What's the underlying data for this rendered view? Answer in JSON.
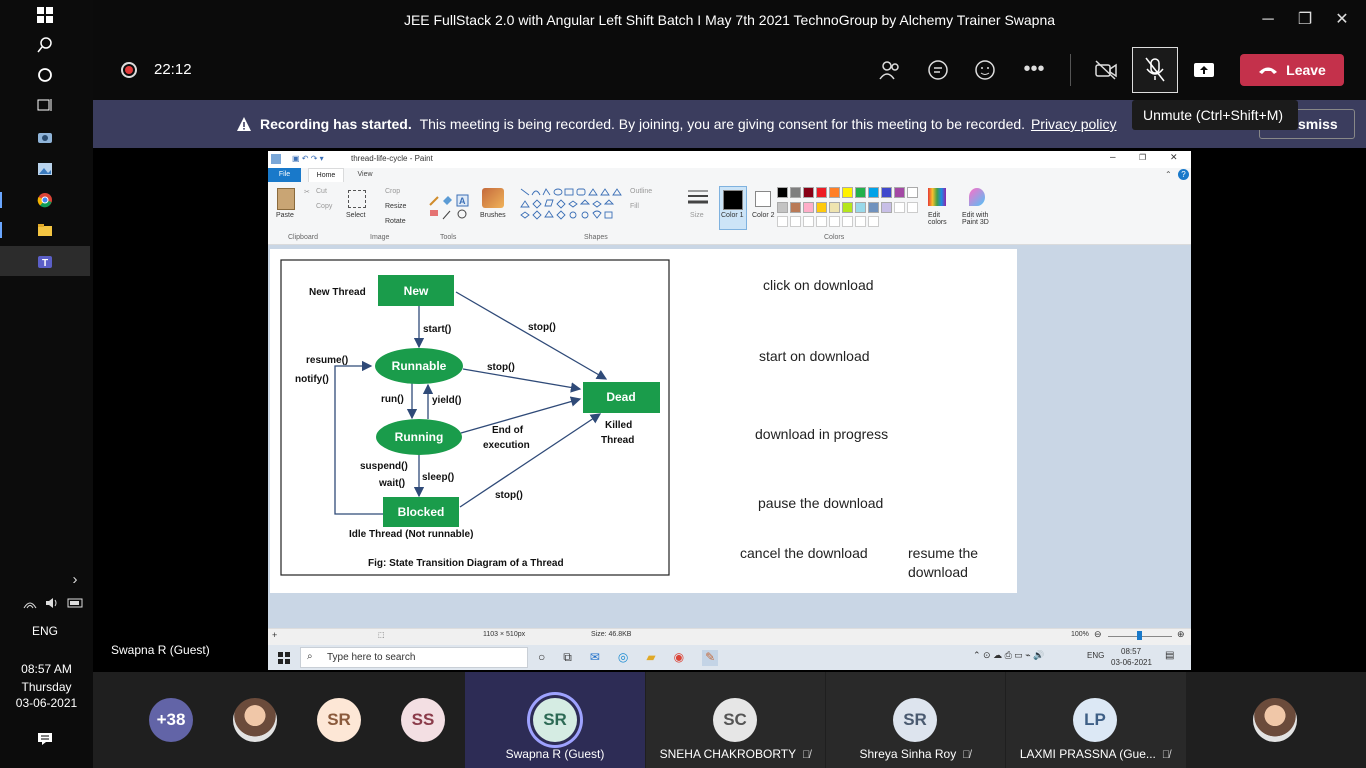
{
  "window": {
    "title": "JEE FullStack 2.0 with Angular Left Shift Batch I May 7th 2021 TechnoGroup by Alchemy Trainer Swapna",
    "minimize_icon": "minimize-icon",
    "maximize_icon": "maximize-icon",
    "close_icon": "close-icon"
  },
  "meeting": {
    "timer": "22:12",
    "leave_label": "Leave",
    "tooltip": "Unmute (Ctrl+Shift+M)",
    "dismiss_label": "smiss",
    "colors": {
      "leave": "#c4314b",
      "banner": "#3b3d5e",
      "avatar_ring": "#9ea2ff"
    }
  },
  "banner": {
    "bold": "Recording has started.",
    "text": "This meeting is being recorded. By joining, you are giving consent for this meeting to be recorded.",
    "link": "Privacy policy"
  },
  "sidebar": {
    "lang": "ENG",
    "time": "08:57 AM",
    "day": "Thursday",
    "date": "03-06-2021"
  },
  "presenter_label": "Swapna R (Guest)",
  "participants": [
    {
      "kind": "count",
      "text": "+38",
      "bg": "#6264a7",
      "fg": "#fff"
    },
    {
      "kind": "photo"
    },
    {
      "kind": "initials",
      "text": "SR",
      "bg": "#fde7d6",
      "fg": "#8a5a3c"
    },
    {
      "kind": "initials",
      "text": "SS",
      "bg": "#f3dfe3",
      "fg": "#8a3b4a"
    },
    {
      "kind": "active",
      "text": "SR",
      "bg": "#d5ece3",
      "fg": "#2d6a55",
      "name": "Swapna R (Guest)"
    },
    {
      "kind": "initials",
      "text": "SC",
      "bg": "#e6e6e6",
      "fg": "#555",
      "name": "SNEHA CHAKROBORTY",
      "muted": true
    },
    {
      "kind": "initials",
      "text": "SR",
      "bg": "#dde4ee",
      "fg": "#4a5a70",
      "name": "Shreya Sinha Roy",
      "muted": true
    },
    {
      "kind": "initials",
      "text": "LP",
      "bg": "#dce8f5",
      "fg": "#3e5f86",
      "name": "LAXMI PRASSNA (Gue...",
      "muted": true
    },
    {
      "kind": "photo"
    }
  ],
  "paint": {
    "title": "thread-life-cycle - Paint",
    "tabs": [
      "File",
      "Home",
      "View"
    ],
    "groups": [
      "Clipboard",
      "Image",
      "Tools",
      "Shapes",
      "Colors"
    ],
    "buttons": {
      "paste": "Paste",
      "cut": "Cut",
      "copy": "Copy",
      "select": "Select",
      "crop": "Crop",
      "resize": "Resize",
      "rotate": "Rotate",
      "brushes": "Brushes",
      "outline": "Outline",
      "fill": "Fill",
      "size": "Size",
      "color1": "Color 1",
      "color2": "Color 2",
      "edit_colors": "Edit colors",
      "edit_paint3d": "Edit with Paint 3D"
    },
    "palette": [
      "#000000",
      "#7f7f7f",
      "#880015",
      "#ed1c24",
      "#ff7f27",
      "#fff200",
      "#22b14c",
      "#00a2e8",
      "#3f48cc",
      "#a349a4",
      "#ffffff",
      "#c3c3c3",
      "#b97a57",
      "#ffaec9",
      "#ffc90e",
      "#efe4b0",
      "#b5e61d",
      "#99d9ea",
      "#7092be",
      "#c8bfe7"
    ],
    "status": {
      "dimensions": "1103 × 510px",
      "size": "Size: 46.8KB",
      "zoom": "100%"
    }
  },
  "diagram": {
    "states": {
      "new": "New",
      "runnable": "Runnable",
      "running": "Running",
      "blocked": "Blocked",
      "dead": "Dead"
    },
    "labels": {
      "new_thread": "New Thread",
      "start": "start()",
      "stop1": "stop()",
      "stop2": "stop()",
      "stop3": "stop()",
      "resume": "resume()",
      "notify": "notify()",
      "run": "run()",
      "yield": "yield()",
      "end1": "End of",
      "end2": "execution",
      "killed1": "Killed",
      "killed2": "Thread",
      "suspend": "suspend()",
      "wait": "wait()",
      "sleep": "sleep()",
      "idle": "Idle Thread (Not runnable)",
      "caption": "Fig: State Transition Diagram of a Thread"
    }
  },
  "notes": {
    "n1": "click on download",
    "n2": "start on download",
    "n3": "download in progress",
    "n4": "pause the download",
    "n5": "cancel the download",
    "n6a": "resume the",
    "n6b": "download"
  },
  "taskbar": {
    "search": "Type here to search",
    "lang": "ENG",
    "time": "08:57",
    "date": "03-06-2021"
  }
}
